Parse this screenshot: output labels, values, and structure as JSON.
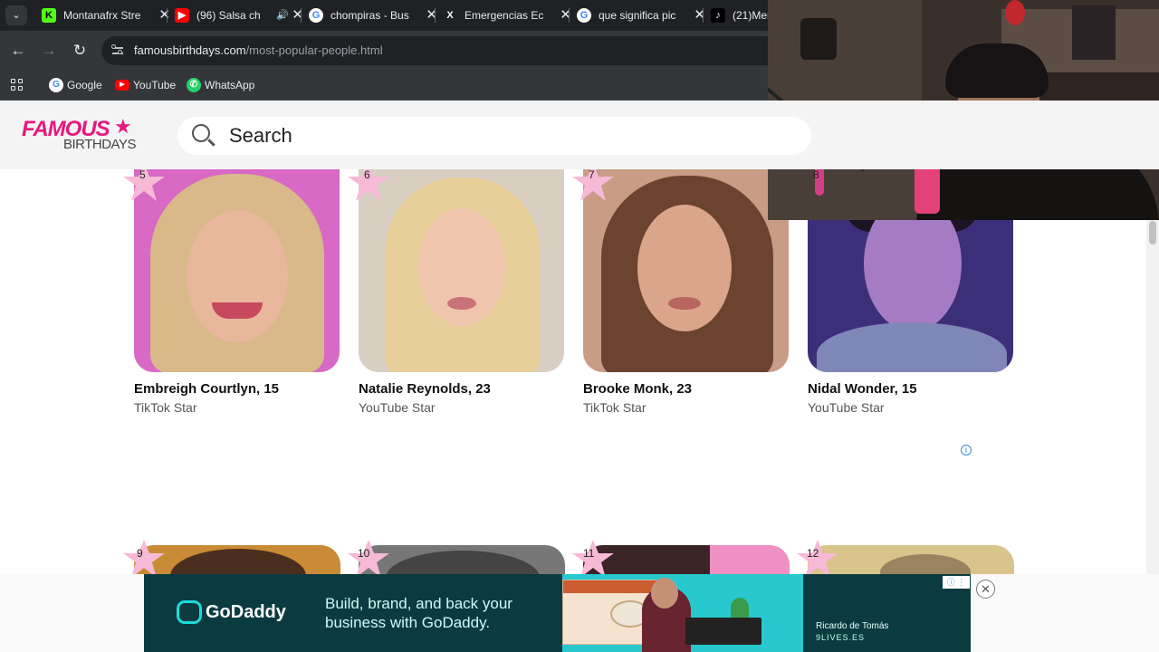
{
  "browser": {
    "tabs": [
      {
        "title": "Montanafrx Stre",
        "favicon": "kick-icon",
        "color": "#53fc18",
        "glyph": "K"
      },
      {
        "title": "(96) Salsa ch",
        "favicon": "youtube-icon",
        "color": "#ff0000",
        "glyph": "▶",
        "audio": true
      },
      {
        "title": "chompiras - Bus",
        "favicon": "google-icon",
        "color": "#4285f4",
        "glyph": "G"
      },
      {
        "title": "Emergencias Ec",
        "favicon": "x-icon",
        "color": "#000000",
        "glyph": "X"
      },
      {
        "title": "que significa pic",
        "favicon": "google-icon",
        "color": "#4285f4",
        "glyph": "G"
      },
      {
        "title": "(21)Men",
        "favicon": "tiktok-icon",
        "color": "#000000",
        "glyph": "♪"
      }
    ],
    "url_host": "famousbirthdays.com",
    "url_path": "/most-popular-people.html",
    "bookmarks": [
      {
        "label": "Google",
        "icon": "google-icon"
      },
      {
        "label": "YouTube",
        "icon": "youtube-icon"
      },
      {
        "label": "WhatsApp",
        "icon": "whatsapp-icon"
      }
    ]
  },
  "site": {
    "logo_line1": "FAMOUS",
    "logo_line2": "BIRTHDAYS",
    "search_placeholder": "Search"
  },
  "people": [
    {
      "rank": "5",
      "name": "Embreigh Courtlyn, 15",
      "job": "TikTok Star",
      "bg": "#d869c4",
      "hair": "#d9b98a",
      "skin": "#e8b79c"
    },
    {
      "rank": "6",
      "name": "Natalie Reynolds, 23",
      "job": "YouTube Star",
      "bg": "#d8cfc2",
      "hair": "#e6cf99",
      "skin": "#efc5ad"
    },
    {
      "rank": "7",
      "name": "Brooke Monk, 23",
      "job": "TikTok Star",
      "bg": "#c99c85",
      "hair": "#6b4330",
      "skin": "#dba58b"
    },
    {
      "rank": "8",
      "name": "Nidal Wonder, 15",
      "job": "YouTube Star",
      "bg": "#3c2f7a",
      "hair": "#1c1424",
      "skin": "#a57cc4"
    }
  ],
  "next_ranks": [
    "9",
    "10",
    "11",
    "12"
  ],
  "ad": {
    "brand": "GoDaddy",
    "headline": "Build, brand, and back your business with GoDaddy.",
    "credit_name": "Ricardo de Tomás",
    "credit_brand": "9LIVES.ES",
    "colors": {
      "background": "#0b3b40",
      "accent": "#1bdbdb"
    }
  },
  "colors": {
    "brand_pink": "#e6197c",
    "rank_star": "#f6b9d6"
  }
}
